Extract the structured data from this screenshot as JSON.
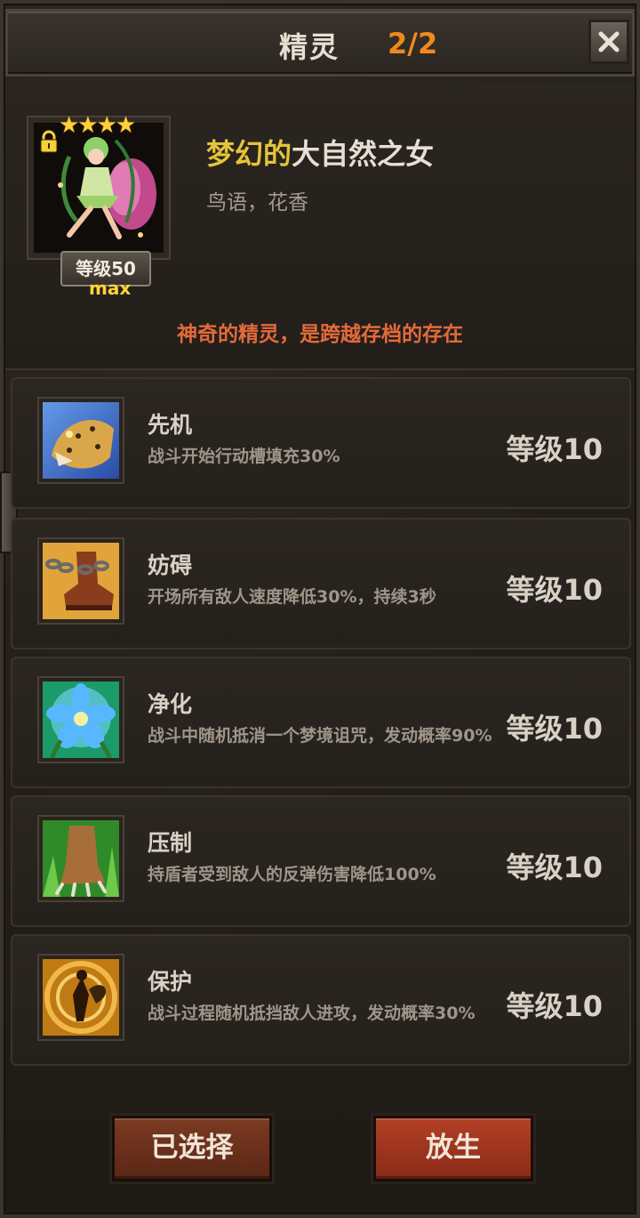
{
  "header": {
    "title": "精灵",
    "count": "2/2"
  },
  "spirit": {
    "stars": "★★★★",
    "level_label": "等级50",
    "level_max": "max",
    "name_prefix": "梦幻的",
    "name_main": "大自然之女",
    "subtitle": "鸟语，花香",
    "description": "神奇的精灵，是跨越存档的存在"
  },
  "skills": [
    {
      "name": "先机",
      "desc": "战斗开始行动槽填充30%",
      "level": "等级10",
      "icon": "leopard-icon"
    },
    {
      "name": "妨碍",
      "desc": "开场所有敌人速度降低30%，持续3秒",
      "level": "等级10",
      "icon": "chained-boot-icon"
    },
    {
      "name": "净化",
      "desc": "战斗中随机抵消一个梦境诅咒，发动概率90%",
      "level": "等级10",
      "icon": "blue-flower-icon"
    },
    {
      "name": "压制",
      "desc": "持盾者受到敌人的反弹伤害降低100%",
      "level": "等级10",
      "icon": "beast-claw-icon"
    },
    {
      "name": "保护",
      "desc": "战斗过程随机抵挡敌人进攻，发动概率30%",
      "level": "等级10",
      "icon": "fairy-shield-icon"
    }
  ],
  "buttons": {
    "selected": "已选择",
    "release": "放生"
  },
  "colors": {
    "accent_orange": "#f08a1c",
    "name_gold": "#e4c43a",
    "desc_red": "#e36a3a",
    "button_red": "#b24026"
  }
}
